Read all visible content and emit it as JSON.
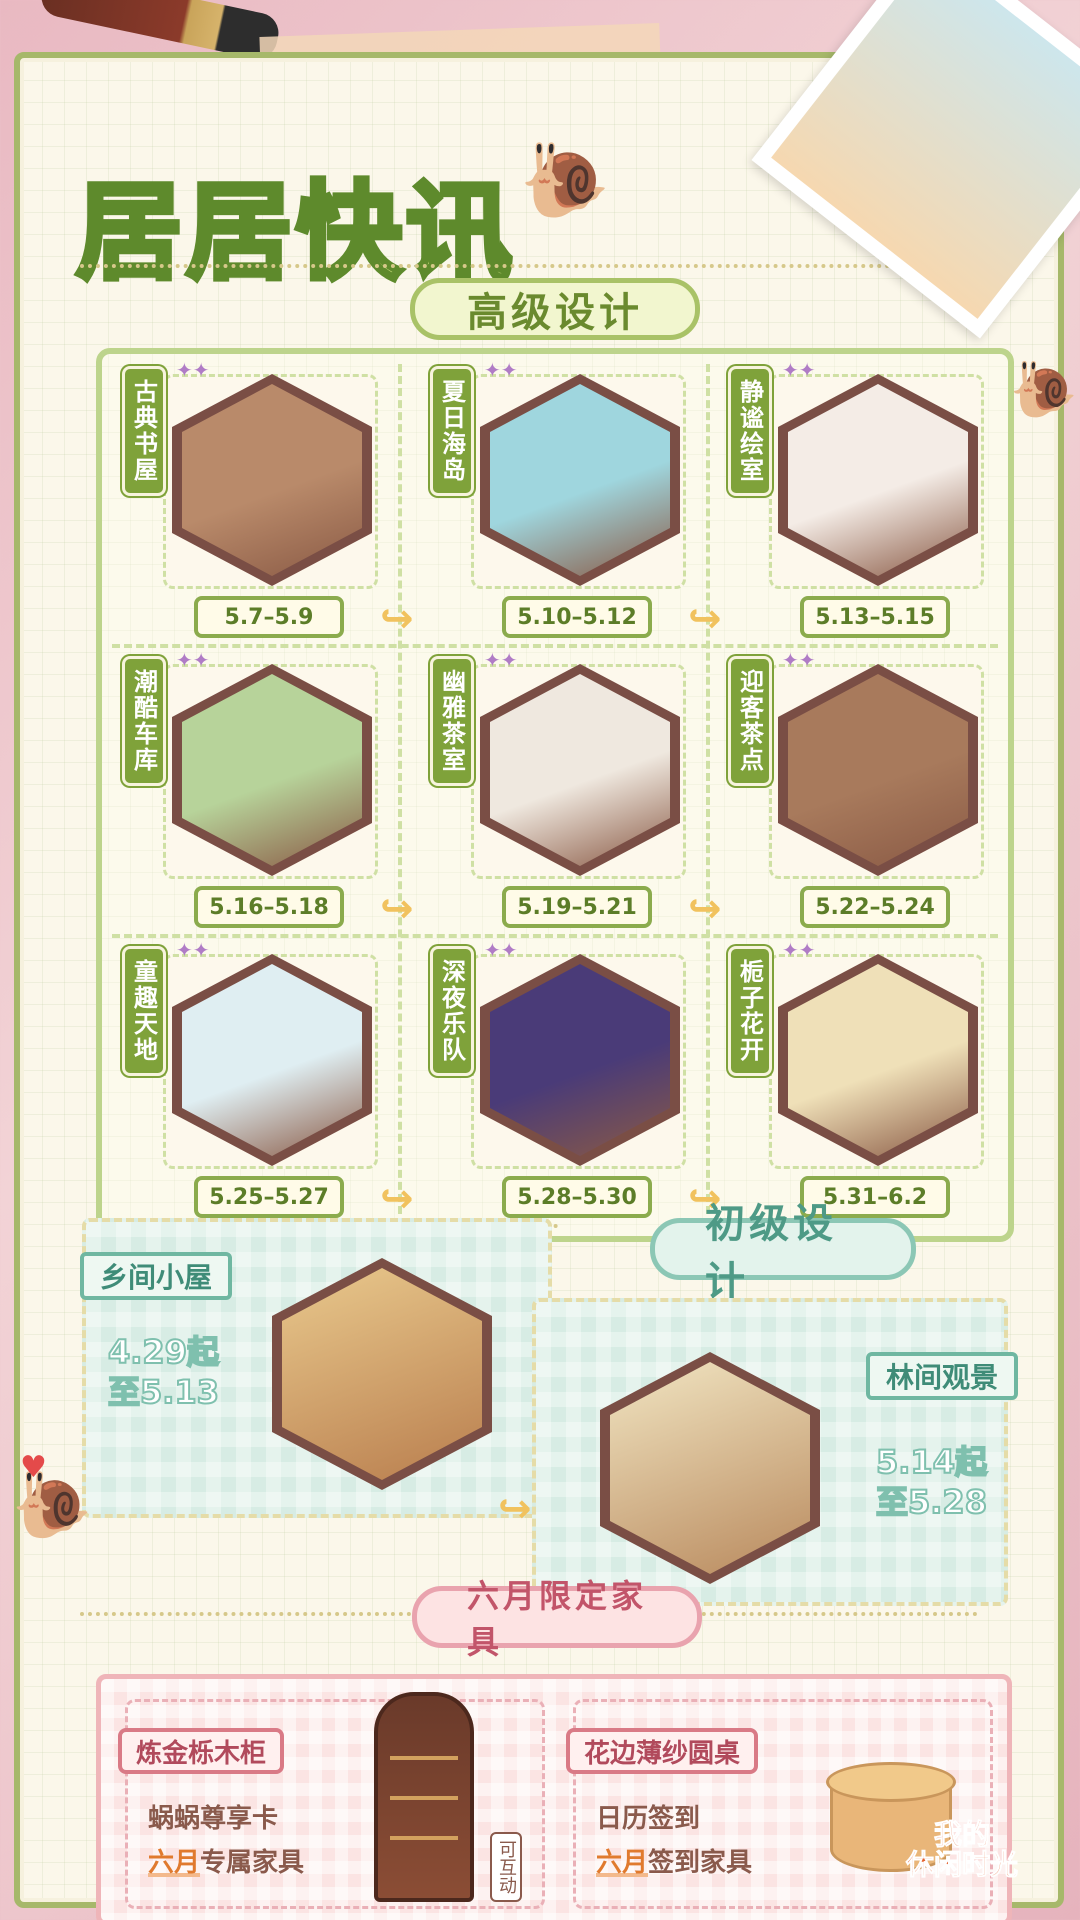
{
  "title": "居居快讯",
  "sections": {
    "advanced": "高级设计",
    "beginner": "初级设计",
    "june": "六月限定家具"
  },
  "advanced_rooms": [
    {
      "name": "古典书屋",
      "date": "5.7–5.9",
      "color": "#b98a6a"
    },
    {
      "name": "夏日海岛",
      "date": "5.10–5.12",
      "color": "#9fd6de"
    },
    {
      "name": "静谧绘室",
      "date": "5.13–5.15",
      "color": "#f4ece6"
    },
    {
      "name": "潮酷车库",
      "date": "5.16–5.18",
      "color": "#b7d39a"
    },
    {
      "name": "幽雅茶室",
      "date": "5.19–5.21",
      "color": "#efe8df"
    },
    {
      "name": "迎客茶点",
      "date": "5.22–5.24",
      "color": "#a87a5c"
    },
    {
      "name": "童趣天地",
      "date": "5.25–5.27",
      "color": "#dfeef2"
    },
    {
      "name": "深夜乐队",
      "date": "5.28–5.30",
      "color": "#4a3b78"
    },
    {
      "name": "栀子花开",
      "date": "5.31–6.2",
      "color": "#efe0b8"
    }
  ],
  "beginner_rooms": [
    {
      "name": "乡间小屋",
      "date_line1": "4.29起",
      "date_line2": "至5.13",
      "color": "#c9925e"
    },
    {
      "name": "林间观景",
      "date_line1": "5.14起",
      "date_line2": "至5.28",
      "color": "#e8d7a8"
    }
  ],
  "june_items": [
    {
      "name": "炼金栎木柜",
      "line1": "蜗蜗尊享卡",
      "line2_hl": "六月",
      "line2_rest": "专属家具",
      "tag": "可互动"
    },
    {
      "name": "花边薄纱圆桌",
      "line1": "日历签到",
      "line2_hl": "六月",
      "line2_rest": "签到家具"
    }
  ],
  "logo": {
    "line1": "我的",
    "line2": "休闲时光",
    "tm": "™"
  }
}
